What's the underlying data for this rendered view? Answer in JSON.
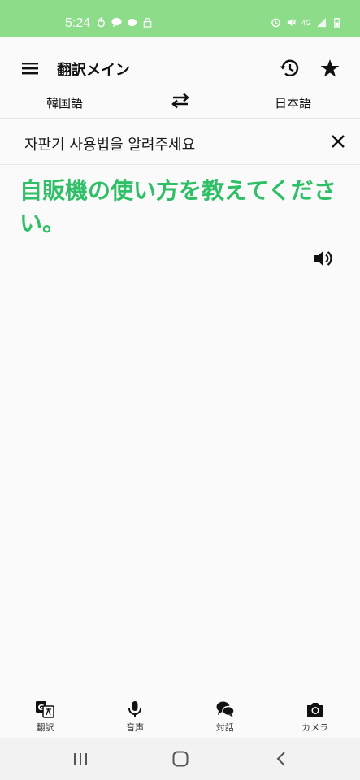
{
  "status_bar": {
    "time": "5:24",
    "left_icons": [
      "fire-icon",
      "chat-bubble-icon",
      "speech-icon",
      "lock-icon"
    ],
    "right_icons": [
      "alarm-icon",
      "mute-icon",
      "4g-icon",
      "signal-icon",
      "battery-icon"
    ],
    "network_label": "4G",
    "background_color": "#8ddc8a"
  },
  "app_bar": {
    "title": "翻訳メイン",
    "source_language": "韓国語",
    "target_language": "日本語"
  },
  "input": {
    "source_text": "자판기 사용법을 알려주세요"
  },
  "result": {
    "translated_text": "自販機の使い方を教えてください。",
    "color": "#2fbf66"
  },
  "bottom_nav": {
    "items": [
      {
        "label": "翻訳",
        "icon": "translate-icon"
      },
      {
        "label": "音声",
        "icon": "microphone-icon"
      },
      {
        "label": "対話",
        "icon": "conversation-icon"
      },
      {
        "label": "カメラ",
        "icon": "camera-icon"
      }
    ]
  },
  "system_nav": {
    "buttons": [
      "recent-apps-icon",
      "home-icon",
      "back-icon"
    ]
  }
}
